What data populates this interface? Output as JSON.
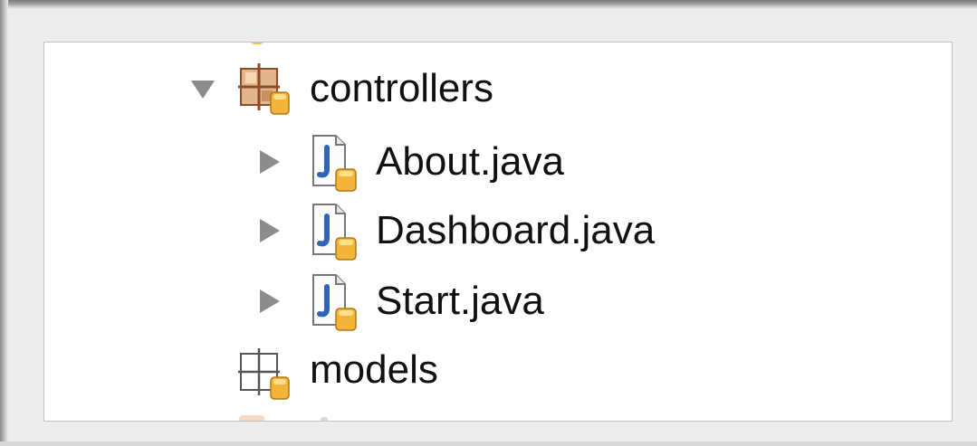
{
  "tree": {
    "items": [
      {
        "label": "controllers",
        "kind": "package",
        "state": "expanded"
      },
      {
        "label": "About.java",
        "kind": "java-file",
        "state": "collapsed"
      },
      {
        "label": "Dashboard.java",
        "kind": "java-file",
        "state": "collapsed"
      },
      {
        "label": "Start.java",
        "kind": "java-file",
        "state": "collapsed"
      },
      {
        "label": "models",
        "kind": "empty-package",
        "state": "leaf"
      }
    ]
  },
  "colors": {
    "package_fill": "#e0b58a",
    "package_stroke": "#8e4b2a",
    "java_badge": "#f3b43a",
    "java_glyph": "#2f64b6",
    "disclosure": "#8c8c8c"
  }
}
